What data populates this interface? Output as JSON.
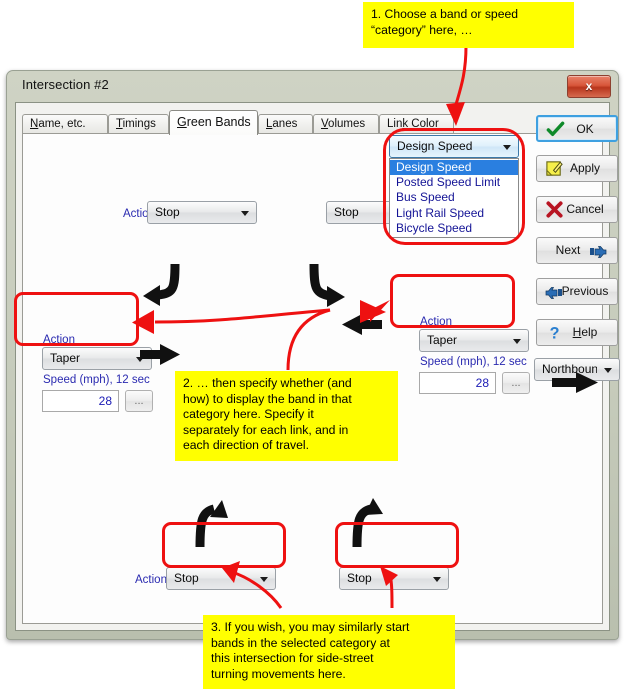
{
  "window": {
    "title": "Intersection #2",
    "close_label": "x"
  },
  "tabs": [
    {
      "label": "Name, etc.",
      "accel": "N",
      "active": false
    },
    {
      "label": "Timings",
      "accel": "T",
      "active": false
    },
    {
      "label": "Green Bands",
      "accel": "G",
      "active": true
    },
    {
      "label": "Lanes",
      "accel": "L",
      "active": false
    },
    {
      "label": "Volumes",
      "accel": "V",
      "active": false
    },
    {
      "label": "Link Color",
      "accel": "k",
      "active": false
    }
  ],
  "category_combo": {
    "value": "Design Speed",
    "options": [
      "Design Speed",
      "Posted Speed Limit",
      "Bus Speed",
      "Light Rail Speed",
      "Bicycle Speed"
    ],
    "selected_index": 0
  },
  "top_row": {
    "action_label": "Action",
    "left_value": "Stop",
    "right_value": "Stop"
  },
  "left_group": {
    "action_label": "Action",
    "action_value": "Taper",
    "speed_label": "Speed (mph), 12 sec",
    "speed_value": "28",
    "browse_label": "..."
  },
  "right_group": {
    "action_label": "Action",
    "action_value": "Taper",
    "speed_label": "Speed (mph), 12 sec",
    "speed_value": "28",
    "browse_label": "..."
  },
  "bottom_row": {
    "action_label": "Action",
    "left_value": "Stop",
    "right_value": "Stop"
  },
  "buttons": [
    {
      "label": "OK",
      "icon": "check-icon"
    },
    {
      "label": "Apply",
      "icon": "pencil-note-icon"
    },
    {
      "label": "Cancel",
      "icon": "x-mark-icon"
    },
    {
      "label": "Next",
      "icon": "hand-right-icon"
    },
    {
      "label": "Previous",
      "icon": "hand-left-icon"
    },
    {
      "label": "Help",
      "icon": "question-mark-icon"
    }
  ],
  "direction_combo": {
    "value": "Northbound"
  },
  "annotations": [
    {
      "id": 1,
      "text": "1. Choose a band or speed\n“category” here, …"
    },
    {
      "id": 2,
      "text": "2. … then specify whether (and\nhow) to display the band in that\ncategory here. Specify it\nseparately for each link, and in\neach direction of travel."
    },
    {
      "id": 3,
      "text": "3. If you wish, you may similarly start\nbands in the selected category at\nthis intersection for side-street\nturning movements here."
    }
  ],
  "colors": {
    "annotation_bg": "#ffff00",
    "highlight": "#ee1111",
    "label_text": "#2a2ab0",
    "selection": "#2a7fe0",
    "window_chrome": "#c6cbbb"
  }
}
